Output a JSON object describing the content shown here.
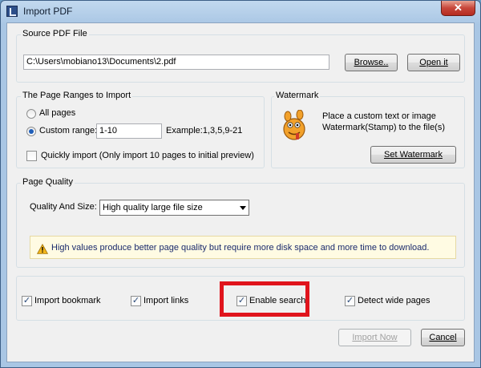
{
  "window": {
    "title": "Import PDF",
    "close_glyph": "✕"
  },
  "source": {
    "group_label": "Source PDF File",
    "path_value": "C:\\Users\\mobiano13\\Documents\\2.pdf",
    "browse_label": "Browse..",
    "open_label": "Open it"
  },
  "ranges": {
    "group_label": "The Page Ranges to Import",
    "all_pages_label": "All pages",
    "custom_range_label": "Custom range:",
    "custom_range_value": "1-10",
    "example_text": "Example:1,3,5,9-21",
    "quick_import_label": "Quickly import (Only import 10 pages to  initial  preview)",
    "selected": "custom",
    "quick_import_checked": false
  },
  "watermark": {
    "group_label": "Watermark",
    "description_line1": "Place a custom text or image",
    "description_line2": "Watermark(Stamp) to the file(s)",
    "button_label": "Set Watermark",
    "icon": "gimp-mascot-icon"
  },
  "quality": {
    "group_label": "Page Quality",
    "field_label": "Quality And Size:",
    "selected_value": "High quality large file size",
    "notice_text": "High values produce better page quality but require more disk space and more time to download.",
    "notice_icon": "warning-icon"
  },
  "options": {
    "import_bookmark": {
      "label": "Import bookmark",
      "checked": true
    },
    "import_links": {
      "label": "Import links",
      "checked": true
    },
    "enable_search": {
      "label": "Enable search",
      "checked": true
    },
    "detect_wide_pages": {
      "label": "Detect wide pages",
      "checked": true
    },
    "check_glyph": "✓"
  },
  "footer": {
    "import_label": "Import Now",
    "cancel_label": "Cancel"
  },
  "colors": {
    "highlight": "#e0141c",
    "accent": "#1f5eb8"
  }
}
